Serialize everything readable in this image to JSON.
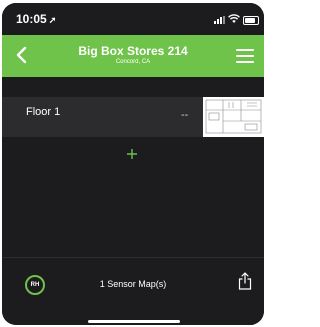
{
  "status_bar": {
    "time": "10:05",
    "location_icon": "location-arrow-icon"
  },
  "nav": {
    "title": "Big Box Stores 214",
    "subtitle": "Concord, CA",
    "back_icon": "chevron-left-icon",
    "menu_icon": "hamburger-menu-icon",
    "background": "#6fc24a"
  },
  "floors": [
    {
      "name": "Floor 1",
      "status": "--"
    }
  ],
  "add_icon": "plus-icon",
  "footer": {
    "initials": "RH",
    "sensor_count": "1 Sensor Map(s)",
    "share_icon": "share-icon"
  },
  "colors": {
    "accent": "#6fc24a",
    "background": "#1c1c1e",
    "row": "#2c2c2e"
  }
}
